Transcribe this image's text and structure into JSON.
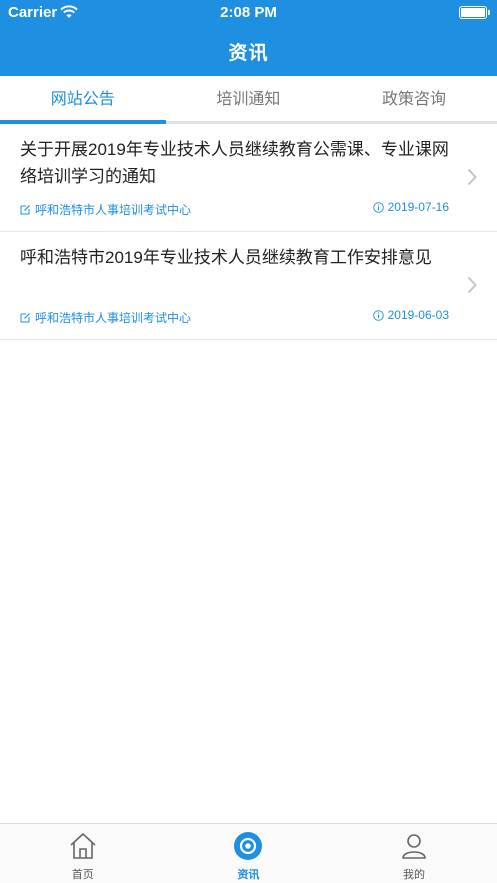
{
  "status_bar": {
    "carrier": "Carrier",
    "time": "2:08 PM"
  },
  "nav": {
    "title": "资讯"
  },
  "tabs": [
    {
      "label": "网站公告",
      "active": true
    },
    {
      "label": "培训通知",
      "active": false
    },
    {
      "label": "政策咨询",
      "active": false
    }
  ],
  "news": [
    {
      "title": "关于开展2019年专业技术人员继续教育公需课、专业课网络培训学习的通知",
      "source": "呼和浩特市人事培训考试中心",
      "date": "2019-07-16"
    },
    {
      "title": "呼和浩特市2019年专业技术人员继续教育工作安排意见",
      "source": "呼和浩特市人事培训考试中心",
      "date": "2019-06-03"
    }
  ],
  "tab_bar": [
    {
      "label": "首页",
      "icon": "home-icon",
      "active": false
    },
    {
      "label": "资讯",
      "icon": "news-icon",
      "active": true
    },
    {
      "label": "我的",
      "icon": "user-icon",
      "active": false
    }
  ],
  "colors": {
    "accent": "#1e8fe1",
    "tab_inactive": "#777777",
    "divider": "#e6e6e6"
  }
}
